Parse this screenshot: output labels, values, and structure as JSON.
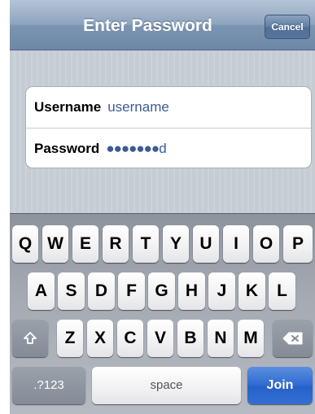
{
  "navbar": {
    "title": "Enter Password",
    "cancel_label": "Cancel"
  },
  "form": {
    "username_label": "Username",
    "username_value": "username",
    "password_label": "Password",
    "password_dots": "●●●●●●●",
    "password_last_char": "d"
  },
  "keyboard": {
    "row1": [
      "Q",
      "W",
      "E",
      "R",
      "T",
      "Y",
      "U",
      "I",
      "O",
      "P"
    ],
    "row2": [
      "A",
      "S",
      "D",
      "F",
      "G",
      "H",
      "J",
      "K",
      "L"
    ],
    "row3": [
      "Z",
      "X",
      "C",
      "V",
      "B",
      "N",
      "M"
    ],
    "mode_label": ".?123",
    "space_label": "space",
    "join_label": "Join",
    "icons": {
      "shift": "shift-icon",
      "delete": "backspace-icon"
    }
  },
  "colors": {
    "nav_bar": "#7b94b1",
    "join_button": "#2f6ad0",
    "field_value_text": "#3d5b93"
  }
}
